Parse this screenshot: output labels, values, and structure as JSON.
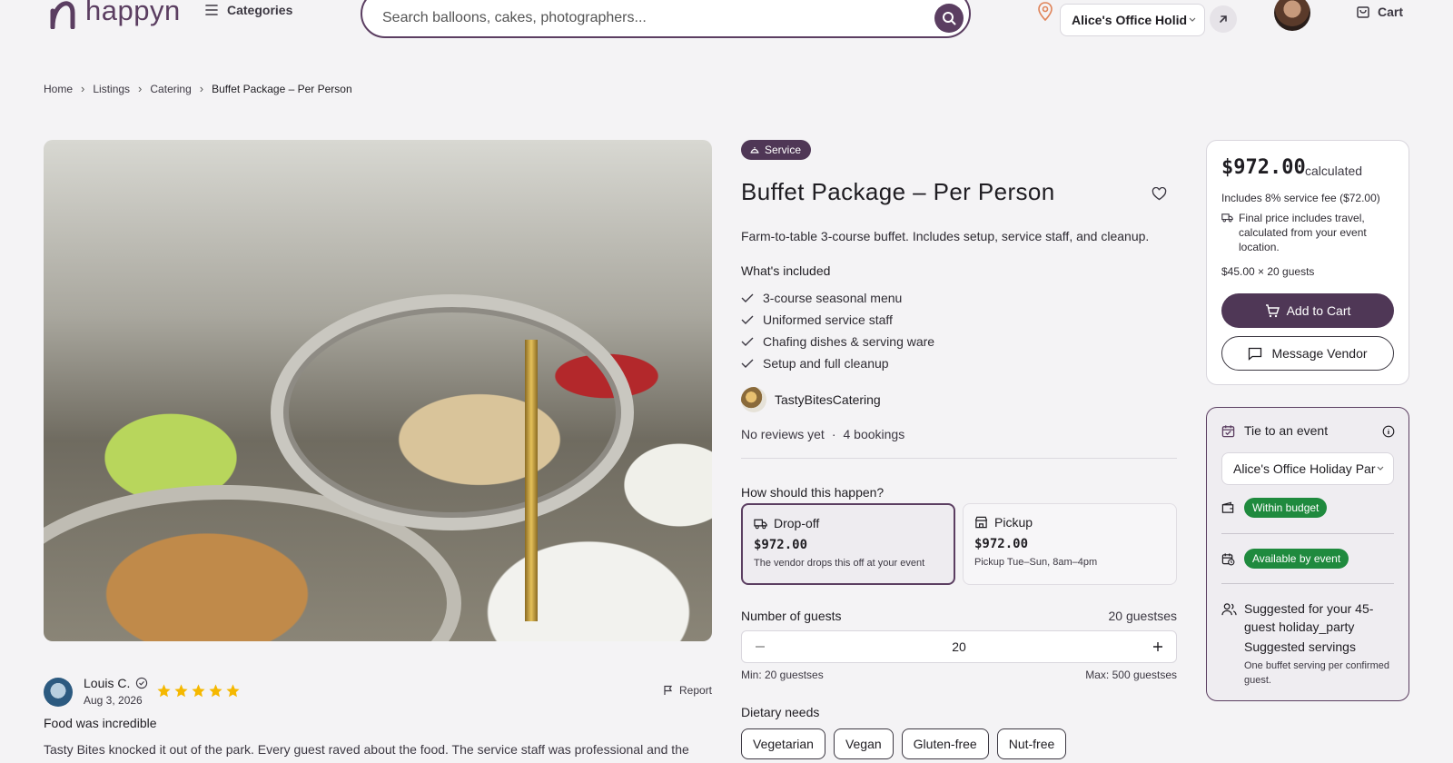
{
  "header": {
    "logo_text": "happyn",
    "categories_label": "Categories",
    "search_placeholder": "Search balloons, cakes, photographers...",
    "event_selector": "Alice's Office Holid",
    "cart_label": "Cart"
  },
  "breadcrumb": [
    "Home",
    "Listings",
    "Catering",
    "Buffet Package – Per Person"
  ],
  "review": {
    "name": "Louis C.",
    "date": "Aug 3, 2026",
    "rating": 5,
    "report_label": "Report",
    "title": "Food was incredible",
    "body": "Tasty Bites knocked it out of the park. Every guest raved about the food. The service staff was professional and the"
  },
  "listing": {
    "badge": "Service",
    "title": "Buffet Package – Per Person",
    "description": "Farm-to-table 3-course buffet. Includes setup, service staff, and cleanup.",
    "included_heading": "What's included",
    "included": [
      "3-course seasonal menu",
      "Uniformed service staff",
      "Chafing dishes & serving ware",
      "Setup and full cleanup"
    ],
    "vendor": "TastyBitesCatering",
    "reviews_text": "No reviews yet",
    "dot": "·",
    "bookings_text": "4 bookings",
    "how_heading": "How should this happen?",
    "options": [
      {
        "name": "Drop-off",
        "price": "$972.00",
        "sub": "The vendor drops this off at your event",
        "selected": true
      },
      {
        "name": "Pickup",
        "price": "$972.00",
        "sub": "Pickup Tue–Sun, 8am–4pm",
        "selected": false
      }
    ],
    "guests_heading": "Number of guests",
    "guests_label": "20 guestses",
    "guests_value": "20",
    "min_label": "Min: 20 guestses",
    "max_label": "Max: 500 guestses",
    "dietary_heading": "Dietary needs",
    "dietary": [
      "Vegetarian",
      "Vegan",
      "Gluten-free",
      "Nut-free"
    ]
  },
  "price_card": {
    "amount": "$972.00",
    "calculated": "calculated",
    "fee": "Includes 8% service fee ($72.00)",
    "travel": "Final price includes travel, calculated from your event location.",
    "calc": "$45.00 × 20 guests",
    "add_to_cart": "Add to Cart",
    "message_vendor": "Message Vendor"
  },
  "event_card": {
    "heading": "Tie to an event",
    "event_name": "Alice's Office Holiday Par",
    "budget_pill": "Within budget",
    "availability_pill": "Available by event",
    "suggested_title": "Suggested for your 45-guest holiday_party",
    "suggested_sub": "Suggested servings",
    "suggested_note": "One buffet serving per confirmed guest."
  },
  "colors": {
    "brand": "#5b3e61",
    "primary_button": "#4f3756",
    "success": "#1f8a3e",
    "star": "#f5b800",
    "background": "#f4f3f5"
  }
}
